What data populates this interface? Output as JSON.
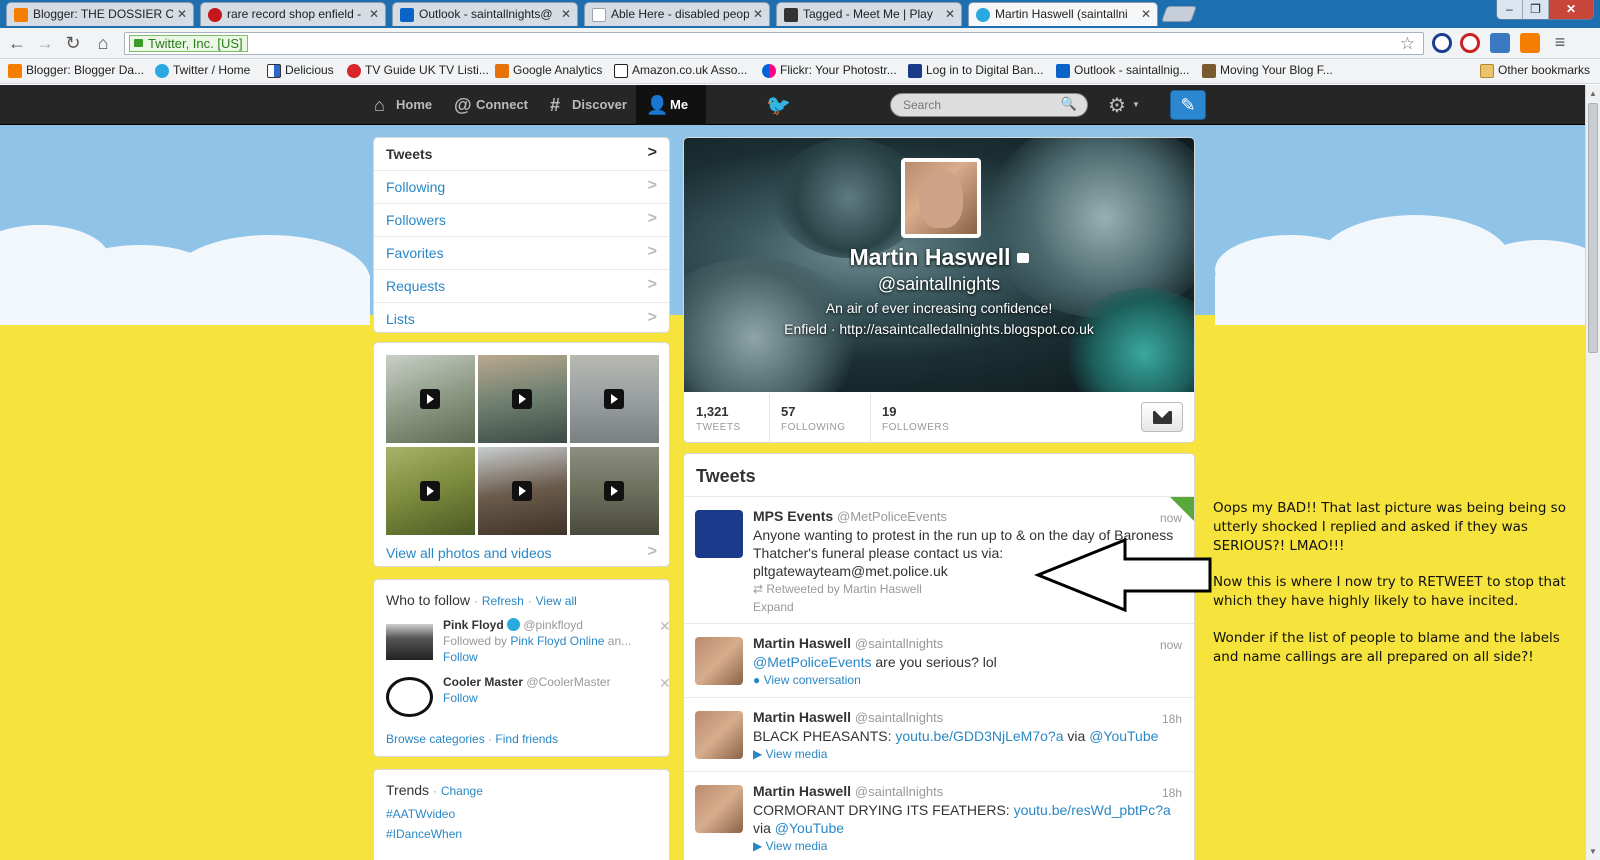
{
  "browser": {
    "tabs": [
      {
        "title": "Blogger: THE DOSSIER OF",
        "color": "#f57d00"
      },
      {
        "title": "rare record shop enfield -",
        "color": "#c4161c"
      },
      {
        "title": "Outlook - saintallnights@",
        "color": "#0a64c8"
      },
      {
        "title": "Able Here - disabled peop",
        "color": "#9aa4ae"
      },
      {
        "title": "Tagged - Meet Me | Play",
        "color": "#333333"
      },
      {
        "title": "Martin Haswell (saintallni",
        "color": "#2aa9e0"
      }
    ],
    "window_buttons": [
      "–",
      "❐",
      "✕"
    ],
    "address_ev": "Twitter, Inc. [US]",
    "bookmarks": [
      {
        "label": "Blogger: Blogger Da...",
        "color": "#f57d00"
      },
      {
        "label": "Twitter / Home",
        "color": "#2aa9e0"
      },
      {
        "label": "Delicious",
        "color": "#2a6ad0"
      },
      {
        "label": "TV Guide UK TV Listi...",
        "color": "#d8262b"
      },
      {
        "label": "Google Analytics",
        "color": "#e8710a"
      },
      {
        "label": "Amazon.co.uk Asso...",
        "color": "#222222"
      },
      {
        "label": "Flickr: Your Photostr...",
        "color": "#ff0084"
      },
      {
        "label": "Log in to Digital Ban...",
        "color": "#1a3a8a"
      },
      {
        "label": "Outlook - saintallnig...",
        "color": "#0a64c8"
      },
      {
        "label": "Moving Your Blog F...",
        "color": "#7a5a30"
      },
      {
        "label": "Other bookmarks",
        "color": "#e9c46a"
      }
    ]
  },
  "topnav": {
    "items": [
      {
        "label": "Home",
        "icon": "⌂"
      },
      {
        "label": "Connect",
        "icon": "@"
      },
      {
        "label": "Discover",
        "icon": "#"
      },
      {
        "label": "Me",
        "icon": "👤"
      }
    ],
    "search_placeholder": "Search"
  },
  "sidebar": {
    "nav": [
      "Tweets",
      "Following",
      "Followers",
      "Favorites",
      "Requests",
      "Lists"
    ],
    "photos_link": "View all photos and videos",
    "wtf": {
      "title": "Who to follow",
      "refresh": "Refresh",
      "view_all": "View all",
      "sep": "·",
      "people": [
        {
          "name": "Pink Floyd",
          "handle": "@pinkfloyd",
          "followed_by_prefix": "Followed by",
          "followed_by": "Pink Floyd Online",
          "followed_by_suffix": "an...",
          "follow": "Follow"
        },
        {
          "name": "Cooler Master",
          "handle": "@CoolerMaster",
          "follow": "Follow"
        }
      ],
      "browse": "Browse categories",
      "find": "Find friends"
    },
    "trends": {
      "title": "Trends",
      "change": "Change",
      "items": [
        "#AATWvideo",
        "#IDanceWhen"
      ]
    }
  },
  "profile": {
    "name": "Martin Haswell",
    "handle": "@saintallnights",
    "bio": "An air of ever increasing confidence!",
    "location": "Enfield",
    "sep": "·",
    "url": "http://asaintcalledallnights.blogspot.co.uk",
    "stats": [
      {
        "value": "1,321",
        "label": "TWEETS"
      },
      {
        "value": "57",
        "label": "FOLLOWING"
      },
      {
        "value": "19",
        "label": "FOLLOWERS"
      }
    ]
  },
  "timeline": {
    "title": "Tweets",
    "tweets": [
      {
        "name": "MPS Events",
        "handle": "@MetPoliceEvents",
        "time": "now",
        "text": "Anyone wanting to protest in the run up to & on the day of Baroness Thatcher's funeral please contact us via: pltgatewayteam@met.police.uk",
        "meta": "Retweeted by Martin Haswell",
        "action": "Expand"
      },
      {
        "name": "Martin Haswell",
        "handle": "@saintallnights",
        "time": "now",
        "mention": "@MetPoliceEvents",
        "text": "are you serious? lol",
        "action": "View conversation"
      },
      {
        "name": "Martin Haswell",
        "handle": "@saintallnights",
        "time": "18h",
        "text": "BLACK PHEASANTS:",
        "link": "youtu.be/GDD3NjLeM7o?a",
        "via": "via",
        "via_link": "@YouTube",
        "action": "View media"
      },
      {
        "name": "Martin Haswell",
        "handle": "@saintallnights",
        "time": "18h",
        "text": "CORMORANT DRYING ITS FEATHERS:",
        "link": "youtu.be/resWd_pbtPc?a",
        "via": "via",
        "via_link": "@YouTube",
        "action": "View media"
      }
    ]
  },
  "annotation": {
    "p1": "Oops my BAD!! That last picture was being being so utterly shocked I replied and asked if they was SERIOUS?! LMAO!!!",
    "p2": "Now this is where I now try to RETWEET to stop that which they have highly likely to have incited.",
    "p3": "Wonder if the list of people to blame and the labels and name callings are all prepared on all side?!"
  }
}
